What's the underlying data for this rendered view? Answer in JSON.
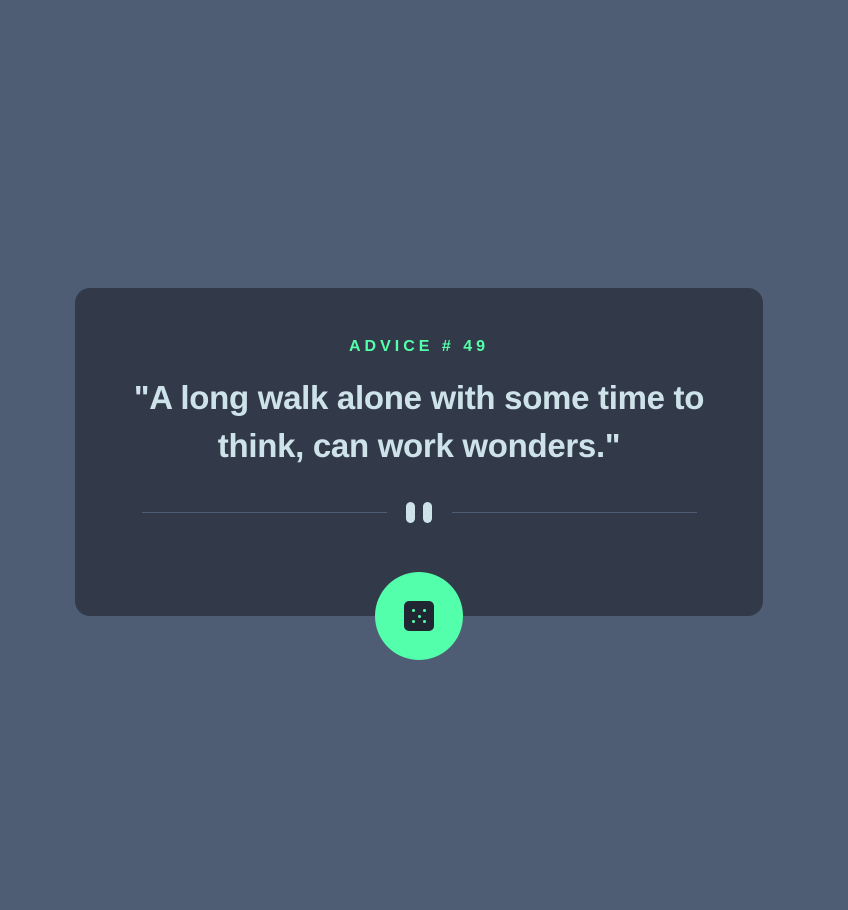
{
  "card": {
    "advice_label": "ADVICE # 49",
    "quote": "\"A long walk alone with some time to think, can work wonders.\""
  },
  "divider": {
    "icon": "pause-icon"
  },
  "button": {
    "icon": "dice-icon",
    "accent_color": "#53ffaa"
  },
  "colors": {
    "background": "#4e5d73",
    "card": "#323a49",
    "accent": "#53ffaa",
    "text": "#cee3e9"
  }
}
